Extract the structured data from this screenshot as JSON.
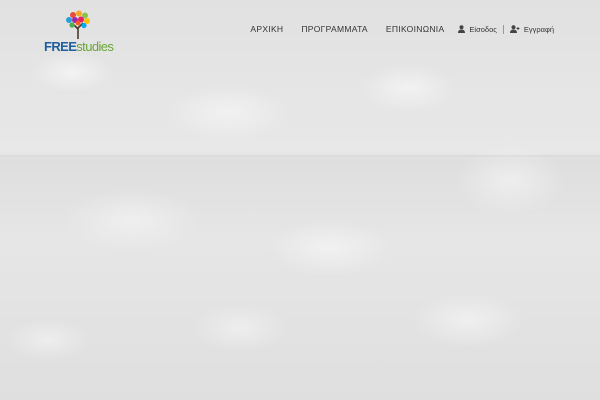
{
  "brand": {
    "logo_text_free": "FREE",
    "logo_text_studies": "studies",
    "colors": {
      "free": "#1f5f9e",
      "studies": "#6aa538"
    }
  },
  "nav": {
    "items": [
      {
        "label": "ΑΡΧΙΚΗ"
      },
      {
        "label": "ΠΡΟΓΡΑΜΜΑΤΑ"
      },
      {
        "label": "ΕΠΙΚΟΙΝΩΝΙΑ"
      }
    ]
  },
  "user": {
    "login_label": "Είσοδος",
    "login_icon": "user-icon",
    "register_label": "Εγγραφή",
    "register_icon": "user-plus-icon"
  }
}
